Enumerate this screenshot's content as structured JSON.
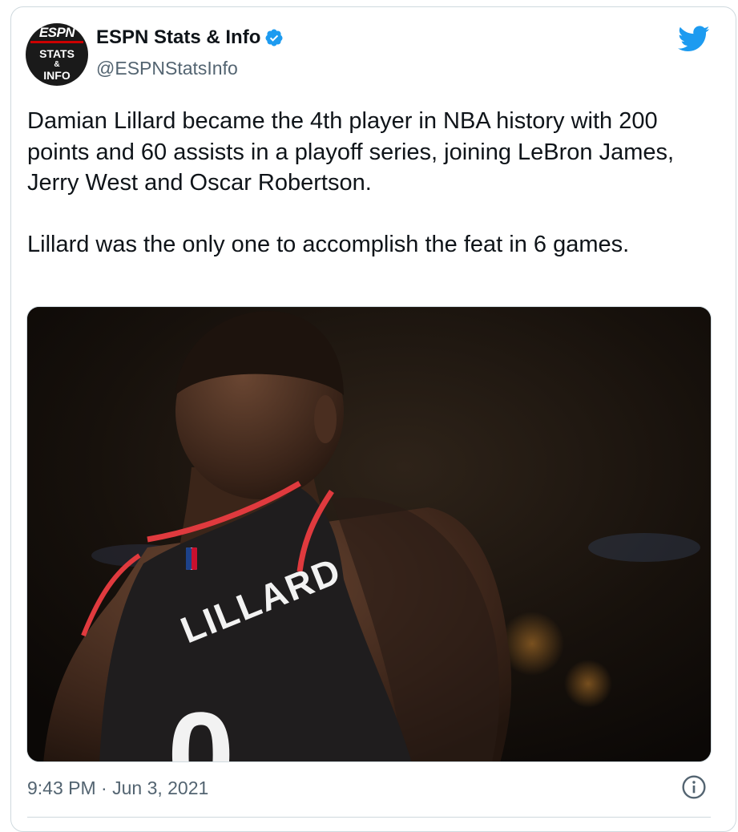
{
  "tweet": {
    "display_name": "ESPN Stats & Info",
    "handle": "@ESPNStatsInfo",
    "avatar": {
      "line1": "ESPN",
      "line2": "STATS",
      "line3": "&",
      "line4": "INFO"
    },
    "text_paragraphs": [
      "Damian Lillard became the 4th player in NBA history with 200 points and 60 assists in a playoff series, joining LeBron James, Jerry West and Oscar Robertson.",
      "Lillard was the only one to accomplish the feat in 6 games."
    ],
    "media": {
      "jersey_name": "LILLARD",
      "jersey_number": "0"
    },
    "timestamp": "9:43 PM · Jun 3, 2021"
  },
  "icons": {
    "verified": "verified-badge-icon",
    "brand": "twitter-bird-icon",
    "info": "info-icon"
  },
  "colors": {
    "twitter_blue": "#1d9bf0",
    "text_primary": "#0f1419",
    "text_secondary": "#536471",
    "border": "#cfd9de"
  }
}
